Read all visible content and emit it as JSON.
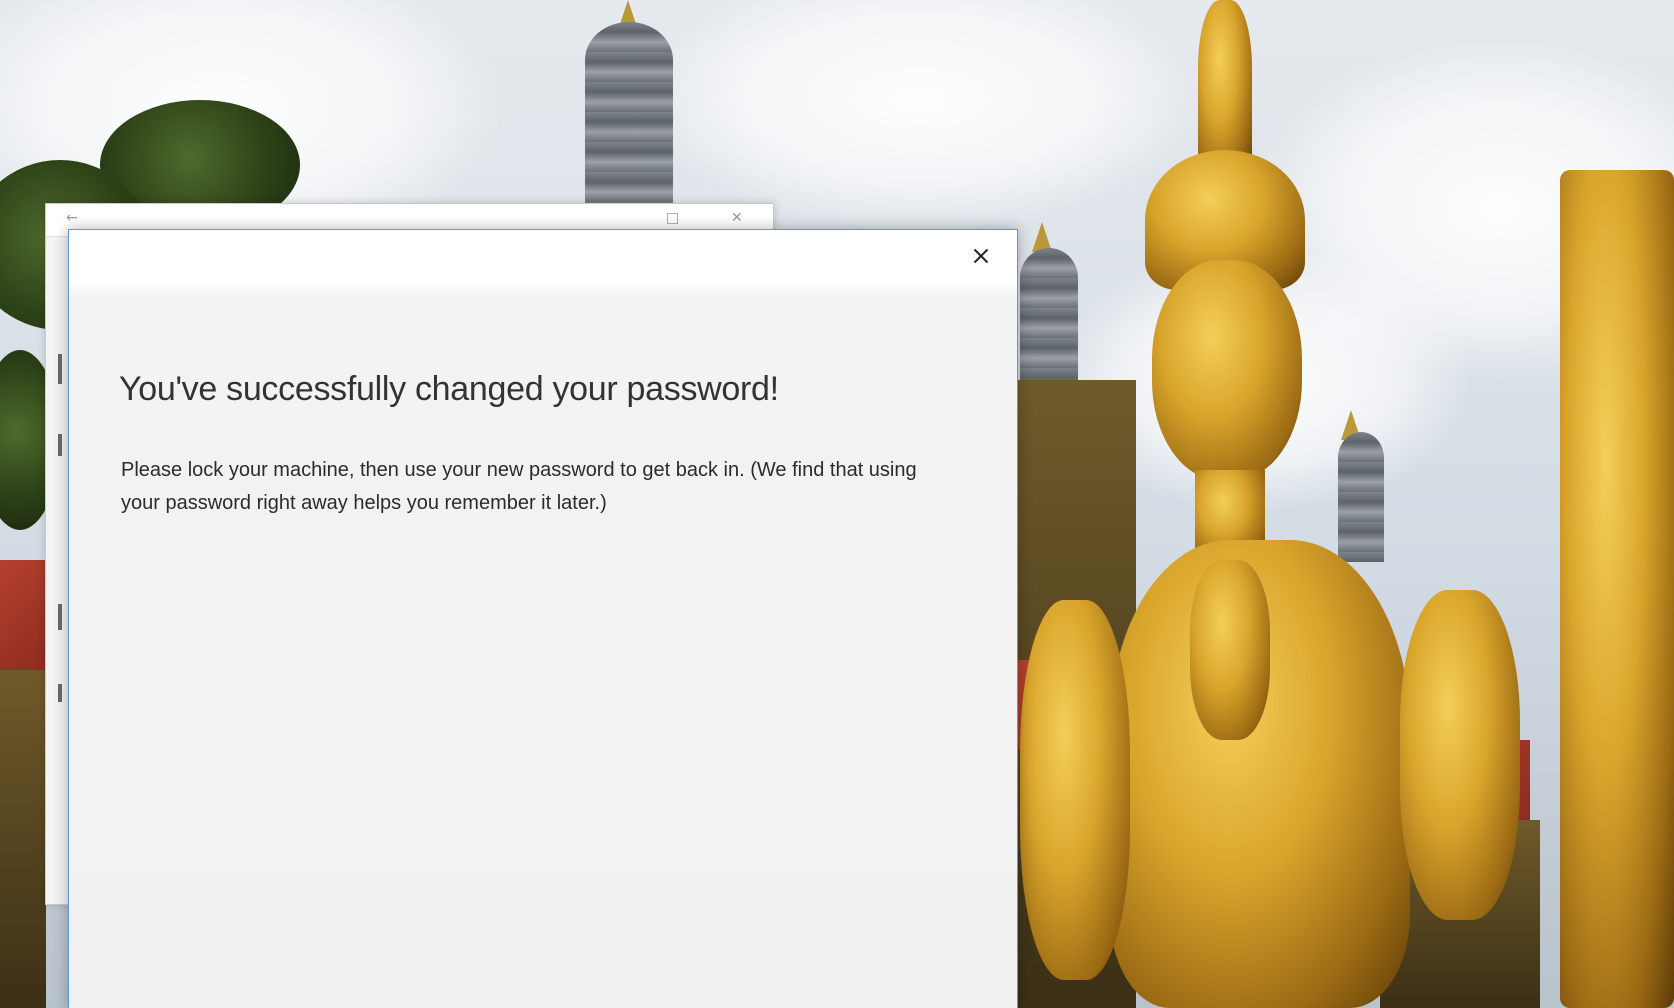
{
  "dialog": {
    "title": "You've successfully changed your password!",
    "message": "Please lock your machine, then use your new password to get back in. (We find that using your password right away helps you remember it later.)",
    "close_icon": "close-icon",
    "accent_color": "#5b9bd5"
  },
  "background_window": {
    "titlebar_icons": [
      "back-arrow-icon",
      "maximize-icon",
      "close-icon"
    ]
  },
  "wallpaper": {
    "description_icon": "temple-wallpaper"
  }
}
